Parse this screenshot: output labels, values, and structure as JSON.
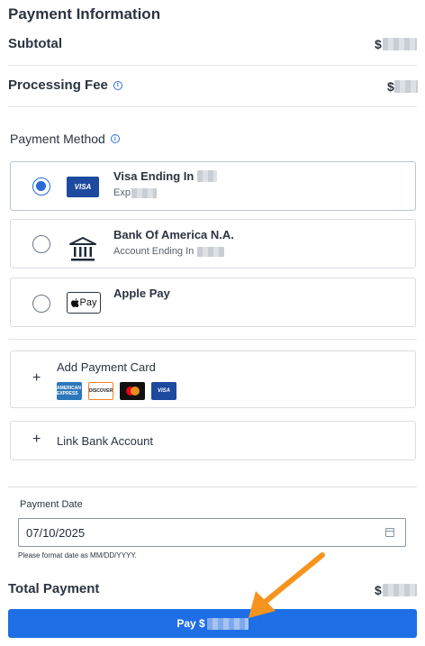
{
  "header": {
    "title": "Payment Information"
  },
  "summary": {
    "subtotal_label": "Subtotal",
    "subtotal_value": "$",
    "fee_label": "Processing Fee",
    "fee_value": "$",
    "total_label": "Total Payment",
    "total_value": "$"
  },
  "payment_method": {
    "label": "Payment Method",
    "methods": [
      {
        "title": "Visa Ending In",
        "subtitle": "Exp",
        "badge": "VISA",
        "selected": true
      },
      {
        "title": "Bank Of America N.A.",
        "subtitle": "Account Ending In",
        "selected": false
      },
      {
        "title": "Apple Pay",
        "badge": "Pay",
        "selected": false
      }
    ]
  },
  "add_card": {
    "label": "Add Payment Card",
    "brands": [
      "AMERICAN EXPRESS",
      "DISCOVER",
      "mastercard",
      "VISA"
    ]
  },
  "link_bank": {
    "label": "Link Bank Account"
  },
  "payment_date": {
    "label": "Payment Date",
    "value": "07/10/2025",
    "help": "Please format date as MM/DD/YYYY."
  },
  "pay_button": {
    "label": "Pay $"
  },
  "colors": {
    "primary": "#1e6fe6",
    "annotation_arrow": "#f7941d"
  },
  "icons": [
    "info-icon",
    "bank-icon",
    "apple-icon",
    "calendar-icon",
    "plus-icon"
  ]
}
